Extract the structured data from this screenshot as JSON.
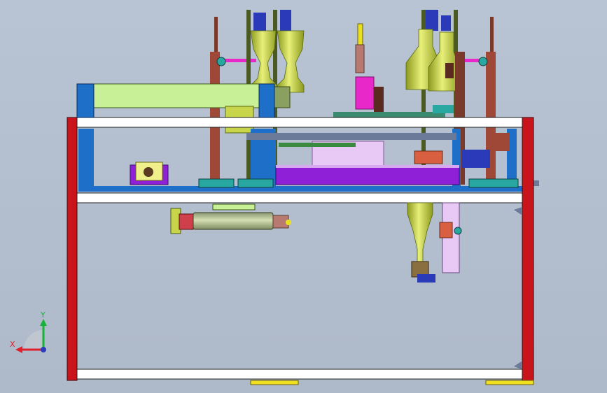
{
  "viewport": {
    "background_top": "#b8c4d4",
    "background_bottom": "#aeb9c9"
  },
  "triad": {
    "x_label": "X",
    "y_label": "Y",
    "x_color": "#e0202a",
    "y_color": "#18b23a",
    "z_color": "#2a3ab8"
  },
  "colors": {
    "frame_red": "#c8141a",
    "frame_white": "#ffffff",
    "frame_blue": "#1e6fc8",
    "cylinder_yellow": "#c8d44a",
    "pale_green": "#c8f096",
    "magenta": "#e828c8",
    "purple": "#9020d8",
    "lavender": "#e8c8f4",
    "brown": "#7a3a2a",
    "teal": "#28a8a0",
    "foot_yellow": "#f0e020"
  }
}
